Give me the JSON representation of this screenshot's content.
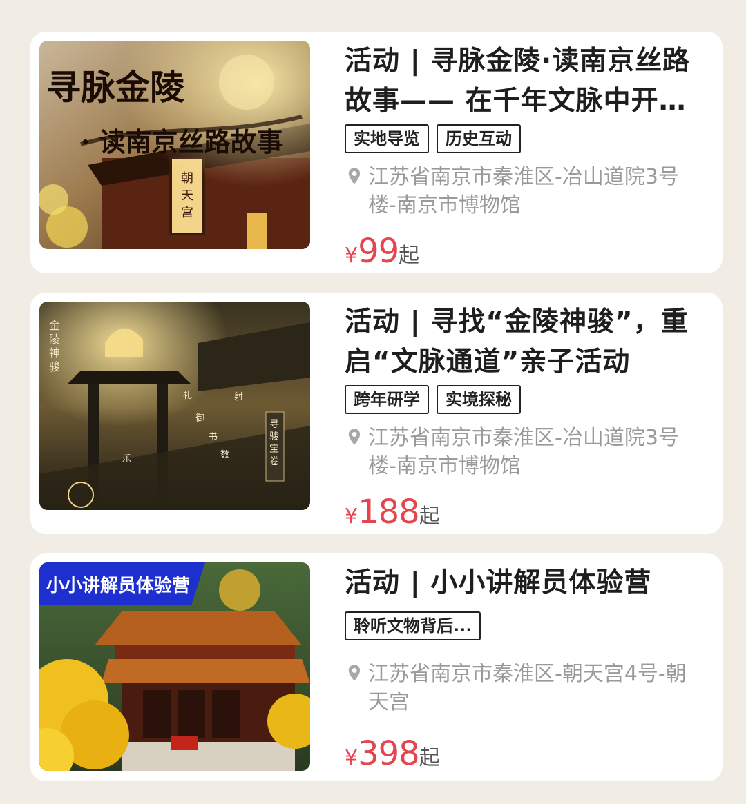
{
  "items": [
    {
      "title": "活动 | 寻脉金陵·读南京丝路故事—— 在千年文脉中开…",
      "tags": [
        "实地导览",
        "历史互动"
      ],
      "location": "江苏省南京市秦淮区-冶山道院3号楼-南京市博物馆",
      "price_prefix": "¥",
      "price": "99",
      "price_suffix": "起",
      "image_text": "寻脉金陵 · 读南京丝路故事",
      "image_sign": "朝天宫"
    },
    {
      "title": "活动 | 寻找“金陵神骏”，重启“文脉通道”亲子活动",
      "tags": [
        "跨年研学",
        "实境探秘"
      ],
      "location": "江苏省南京市秦淮区-冶山道院3号楼-南京市博物馆",
      "price_prefix": "¥",
      "price": "188",
      "price_suffix": "起",
      "image_text": "金陵神骏",
      "image_sign": "寻骏宝卷",
      "image_marks": [
        "礼",
        "射",
        "御",
        "书",
        "数",
        "乐"
      ]
    },
    {
      "title": "活动 | 小小讲解员体验营",
      "tags": [
        "聆听文物背后..."
      ],
      "location": "江苏省南京市秦淮区-朝天宫4号-朝天宫",
      "price_prefix": "¥",
      "price": "398",
      "price_suffix": "起",
      "image_text": "小小讲解员体验营"
    }
  ],
  "colors": {
    "page_bg": "#f2ede4",
    "price": "#e5454e",
    "location": "#9a9a9a",
    "title": "#1e1e1e"
  },
  "icons": [
    "location-pin-icon"
  ]
}
